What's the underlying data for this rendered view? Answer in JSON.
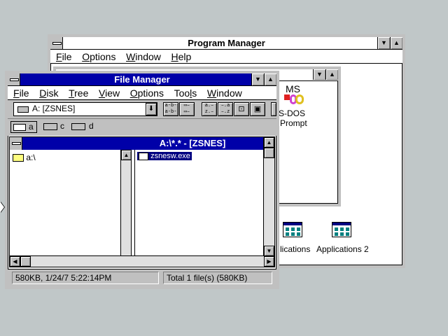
{
  "program_manager": {
    "title": "Program Manager",
    "menu": [
      "File",
      "Options",
      "Window",
      "Help"
    ],
    "menu_accel": [
      "F",
      "O",
      "W",
      "H"
    ],
    "group_icons": [
      {
        "label": "lications",
        "icon": "application-group-icon"
      },
      {
        "label": "Applications 2",
        "icon": "application-group-icon"
      }
    ],
    "msdos": {
      "line1": "S-DOS",
      "line2": "Prompt",
      "logo_text": "MS"
    }
  },
  "file_manager": {
    "title": "File Manager",
    "menu": [
      "File",
      "Disk",
      "Tree",
      "View",
      "Options",
      "Tools",
      "Window"
    ],
    "menu_accel": [
      "F",
      "D",
      "T",
      "V",
      "O",
      "l",
      "W"
    ],
    "drive_select": "A: [ZSNES]",
    "drives": [
      {
        "letter": "a",
        "icon": "floppy-drive-icon"
      },
      {
        "letter": "c",
        "icon": "hard-drive-icon"
      },
      {
        "letter": "d",
        "icon": "cdrom-drive-icon"
      }
    ],
    "doc_title": "A:\\*.* - [ZSNES]",
    "tree_root": "a:\\",
    "files": [
      "zsnesw.exe"
    ],
    "status_left": "580KB, 1/24/7 5:22:14PM",
    "status_right": "Total 1 file(s) (580KB)"
  },
  "colors": {
    "desktop": "#c0c7c8",
    "active_title": "#0000a8",
    "selection": "#000080"
  }
}
